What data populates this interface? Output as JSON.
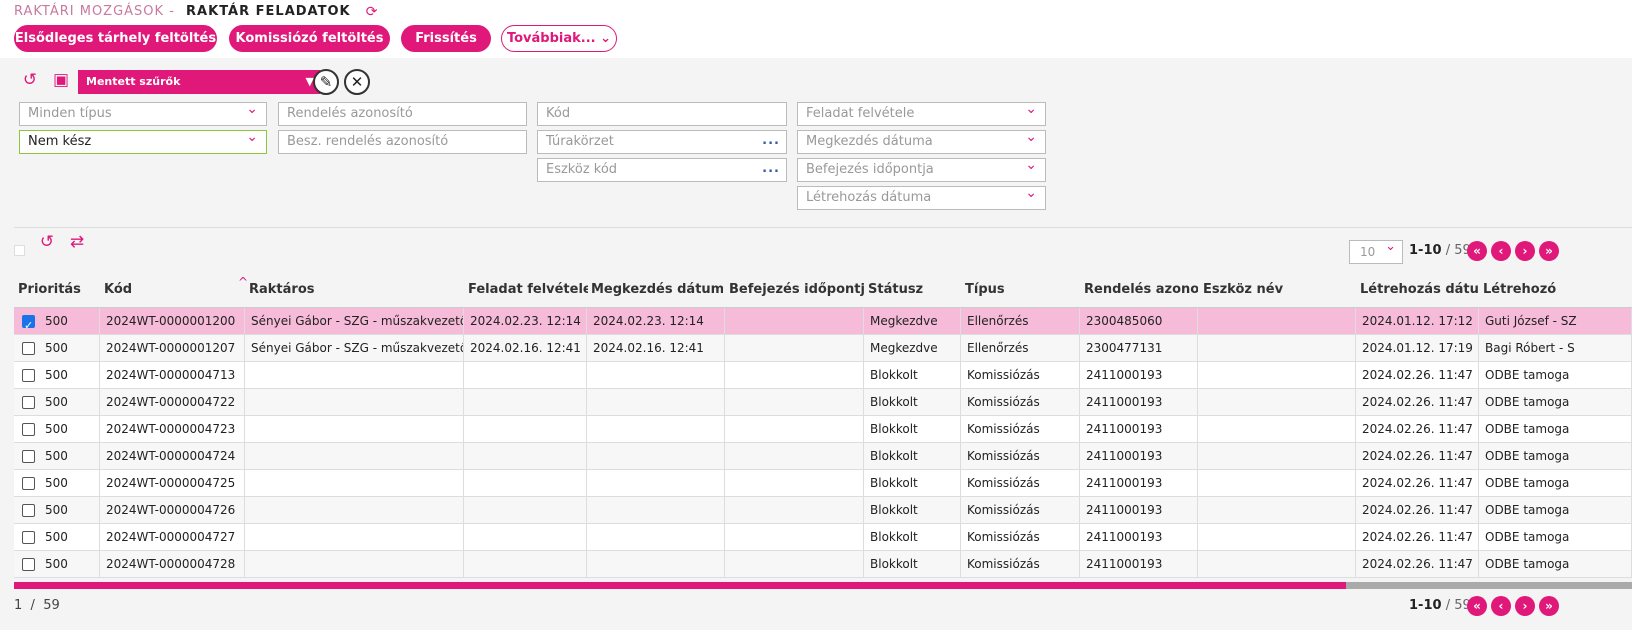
{
  "breadcrumb": {
    "parent": "RAKTÁRI MOZGÁSOK -",
    "current": "RAKTÁR FELADATOK",
    "refresh_icon": "refresh-icon"
  },
  "actions": {
    "primary_storage_fill": "Elsődleges tárhely feltöltés",
    "picker_fill": "Komissiózó feltöltés",
    "refresh": "Frissítés",
    "more": "Továbbiak..."
  },
  "filters": {
    "saved_filters": "Mentett szűrők",
    "type": "Minden típus",
    "status": "Nem kész",
    "order_id_placeholder": "Rendelés azonosító",
    "purchase_order_placeholder": "Besz. rendelés azonosító",
    "code_placeholder": "Kód",
    "route_area_placeholder": "Túrakörzet",
    "device_code_placeholder": "Eszköz kód",
    "task_received": "Feladat felvétele",
    "start_date": "Megkezdés dátuma",
    "end_time": "Befejezés időpontja",
    "created_date": "Létrehozás dátuma"
  },
  "pagination": {
    "page_size": "10",
    "range": "1-10",
    "total": "/ 59",
    "footer_page": "1",
    "footer_sep": "/",
    "footer_total": "59"
  },
  "colors": {
    "accent": "#e0187a",
    "selected_row": "#f6bbd9"
  },
  "table": {
    "headers": [
      "Prioritás",
      "Kód",
      "Raktáros",
      "Feladat felvétele",
      "Megkezdés dátuma",
      "Befejezés időpontja",
      "Státusz",
      "Típus",
      "Rendelés azonosító",
      "Eszköz név",
      "Létrehozás dátuma",
      "Létrehozó"
    ],
    "rows": [
      {
        "checked": true,
        "cells": [
          "500",
          "2024WT-0000001200",
          "Sényei Gábor - SZG - műszakvezető",
          "2024.02.23. 12:14",
          "2024.02.23. 12:14",
          "",
          "Megkezdve",
          "Ellenőrzés",
          "2300485060",
          "",
          "2024.01.12. 17:12",
          "Guti József - SZ"
        ]
      },
      {
        "checked": false,
        "cells": [
          "500",
          "2024WT-0000001207",
          "Sényei Gábor - SZG - műszakvezető",
          "2024.02.16. 12:41",
          "2024.02.16. 12:41",
          "",
          "Megkezdve",
          "Ellenőrzés",
          "2300477131",
          "",
          "2024.01.12. 17:19",
          "Bagi Róbert - S"
        ]
      },
      {
        "checked": false,
        "cells": [
          "500",
          "2024WT-0000004713",
          "",
          "",
          "",
          "",
          "Blokkolt",
          "Komissiózás",
          "2411000193",
          "",
          "2024.02.26. 11:47",
          "ODBE tamoga"
        ]
      },
      {
        "checked": false,
        "cells": [
          "500",
          "2024WT-0000004722",
          "",
          "",
          "",
          "",
          "Blokkolt",
          "Komissiózás",
          "2411000193",
          "",
          "2024.02.26. 11:47",
          "ODBE tamoga"
        ]
      },
      {
        "checked": false,
        "cells": [
          "500",
          "2024WT-0000004723",
          "",
          "",
          "",
          "",
          "Blokkolt",
          "Komissiózás",
          "2411000193",
          "",
          "2024.02.26. 11:47",
          "ODBE tamoga"
        ]
      },
      {
        "checked": false,
        "cells": [
          "500",
          "2024WT-0000004724",
          "",
          "",
          "",
          "",
          "Blokkolt",
          "Komissiózás",
          "2411000193",
          "",
          "2024.02.26. 11:47",
          "ODBE tamoga"
        ]
      },
      {
        "checked": false,
        "cells": [
          "500",
          "2024WT-0000004725",
          "",
          "",
          "",
          "",
          "Blokkolt",
          "Komissiózás",
          "2411000193",
          "",
          "2024.02.26. 11:47",
          "ODBE tamoga"
        ]
      },
      {
        "checked": false,
        "cells": [
          "500",
          "2024WT-0000004726",
          "",
          "",
          "",
          "",
          "Blokkolt",
          "Komissiózás",
          "2411000193",
          "",
          "2024.02.26. 11:47",
          "ODBE tamoga"
        ]
      },
      {
        "checked": false,
        "cells": [
          "500",
          "2024WT-0000004727",
          "",
          "",
          "",
          "",
          "Blokkolt",
          "Komissiózás",
          "2411000193",
          "",
          "2024.02.26. 11:47",
          "ODBE tamoga"
        ]
      },
      {
        "checked": false,
        "cells": [
          "500",
          "2024WT-0000004728",
          "",
          "",
          "",
          "",
          "Blokkolt",
          "Komissiózás",
          "2411000193",
          "",
          "2024.02.26. 11:47",
          "ODBE tamoga"
        ]
      }
    ]
  }
}
